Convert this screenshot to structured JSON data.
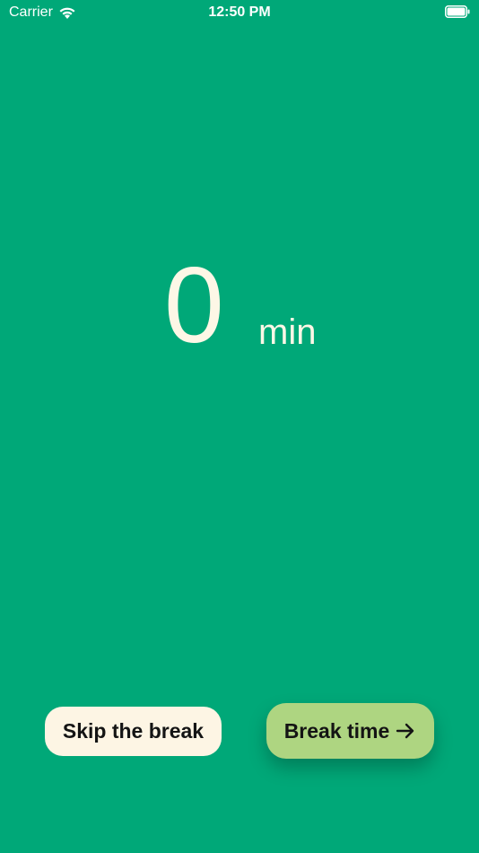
{
  "status_bar": {
    "carrier": "Carrier",
    "time": "12:50 PM",
    "icons": [
      "wifi-icon",
      "battery-icon"
    ]
  },
  "timer": {
    "value": "0",
    "unit": "min"
  },
  "actions": {
    "skip_label": "Skip the break",
    "break_label": "Break time",
    "break_icon": "arrow-right-icon"
  },
  "colors": {
    "background": "#00A878",
    "timer_text": "#FDF7E6",
    "skip_button": "#FDF5E4",
    "break_button": "#AED581"
  }
}
